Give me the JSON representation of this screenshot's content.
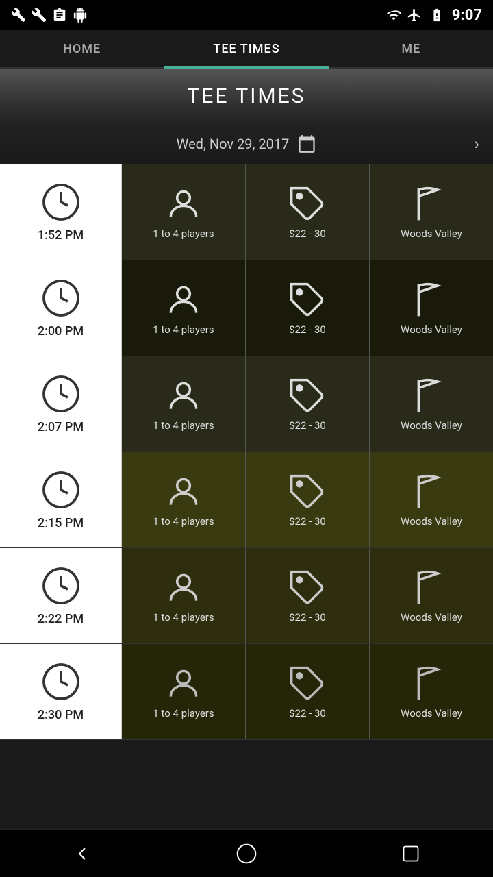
{
  "statusBar": {
    "time": "9:07",
    "icons": [
      "wrench",
      "wrench2",
      "clipboard",
      "android",
      "wifi",
      "airplane",
      "battery"
    ]
  },
  "nav": {
    "tabs": [
      {
        "id": "home",
        "label": "HOME",
        "active": false
      },
      {
        "id": "tee-times",
        "label": "TEE TIMES",
        "active": true
      },
      {
        "id": "me",
        "label": "ME",
        "active": false
      }
    ]
  },
  "header": {
    "title": "TEE TIMES"
  },
  "dateBar": {
    "date": "Wed, Nov 29, 2017"
  },
  "teeRows": [
    {
      "time": "1:52 PM",
      "players": "1 to 4 players",
      "price": "$22 - 30",
      "course": "Woods Valley"
    },
    {
      "time": "2:00 PM",
      "players": "1 to 4 players",
      "price": "$22 - 30",
      "course": "Woods Valley"
    },
    {
      "time": "2:07 PM",
      "players": "1 to 4 players",
      "price": "$22 - 30",
      "course": "Woods Valley"
    },
    {
      "time": "2:15 PM",
      "players": "1 to 4 players",
      "price": "$22 - 30",
      "course": "Woods Valley"
    },
    {
      "time": "2:22 PM",
      "players": "1 to 4 players",
      "price": "$22 - 30",
      "course": "Woods Valley"
    },
    {
      "time": "2:30 PM",
      "players": "1 to 4 players",
      "price": "$22 - 30",
      "course": "Woods Valley"
    }
  ],
  "bottomNav": {
    "back": "◁",
    "home": "○",
    "recents": "□"
  }
}
